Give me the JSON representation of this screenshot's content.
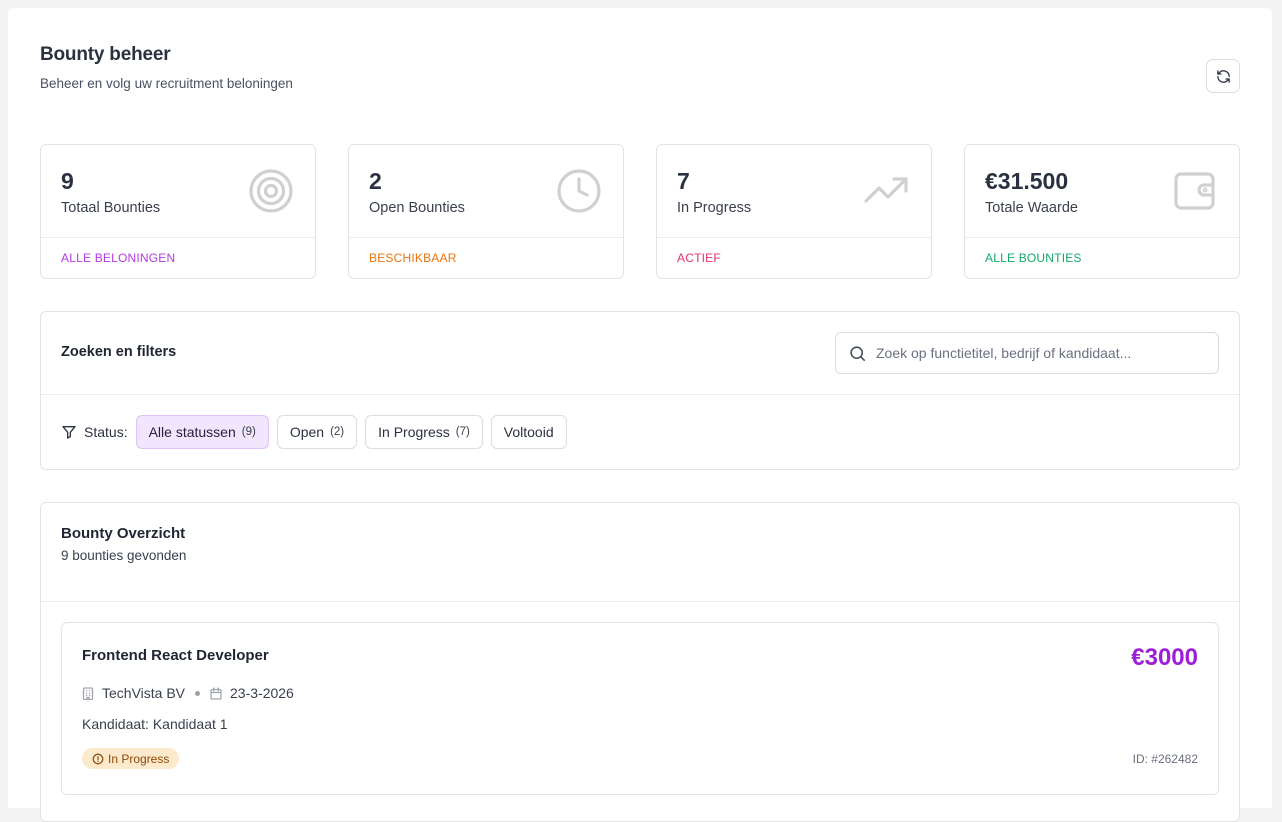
{
  "header": {
    "title": "Bounty beheer",
    "subtitle": "Beheer en volg uw recruitment beloningen",
    "refresh_icon": "refresh-icon"
  },
  "stats": [
    {
      "value": "9",
      "label": "Totaal Bounties",
      "footer": "ALLE BELONINGEN",
      "footer_color": "#b43ae0",
      "icon": "target-icon"
    },
    {
      "value": "2",
      "label": "Open Bounties",
      "footer": "BESCHIKBAAR",
      "footer_color": "#e8740c",
      "icon": "clock-icon"
    },
    {
      "value": "7",
      "label": "In Progress",
      "footer": "ACTIEF",
      "footer_color": "#e0336e",
      "icon": "trending-up-icon"
    },
    {
      "value": "€31.500",
      "label": "Totale Waarde",
      "footer": "ALLE BOUNTIES",
      "footer_color": "#12a86a",
      "icon": "wallet-icon"
    }
  ],
  "filters": {
    "title": "Zoeken en filters",
    "search_placeholder": "Zoek op functietitel, bedrijf of kandidaat...",
    "search_value": "",
    "status_label": "Status:",
    "chips": [
      {
        "label": "Alle statussen",
        "count": "(9)",
        "active": true
      },
      {
        "label": "Open",
        "count": "(2)",
        "active": false
      },
      {
        "label": "In Progress",
        "count": "(7)",
        "active": false
      },
      {
        "label": "Voltooid",
        "count": "",
        "active": false
      }
    ]
  },
  "overview": {
    "title": "Bounty Overzicht",
    "subtitle": "9 bounties gevonden",
    "bounties": [
      {
        "title": "Frontend React Developer",
        "amount": "€3000",
        "company": "TechVista BV",
        "date": "23-3-2026",
        "candidate": "Kandidaat: Kandidaat 1",
        "status": "In Progress",
        "id": "ID: #262482"
      }
    ]
  },
  "colors": {
    "accent": "#9d1fd9",
    "chip_active_bg": "#f1e6fd",
    "badge_bg": "#fde9cc",
    "icon_gray": "#d0d0d3"
  }
}
